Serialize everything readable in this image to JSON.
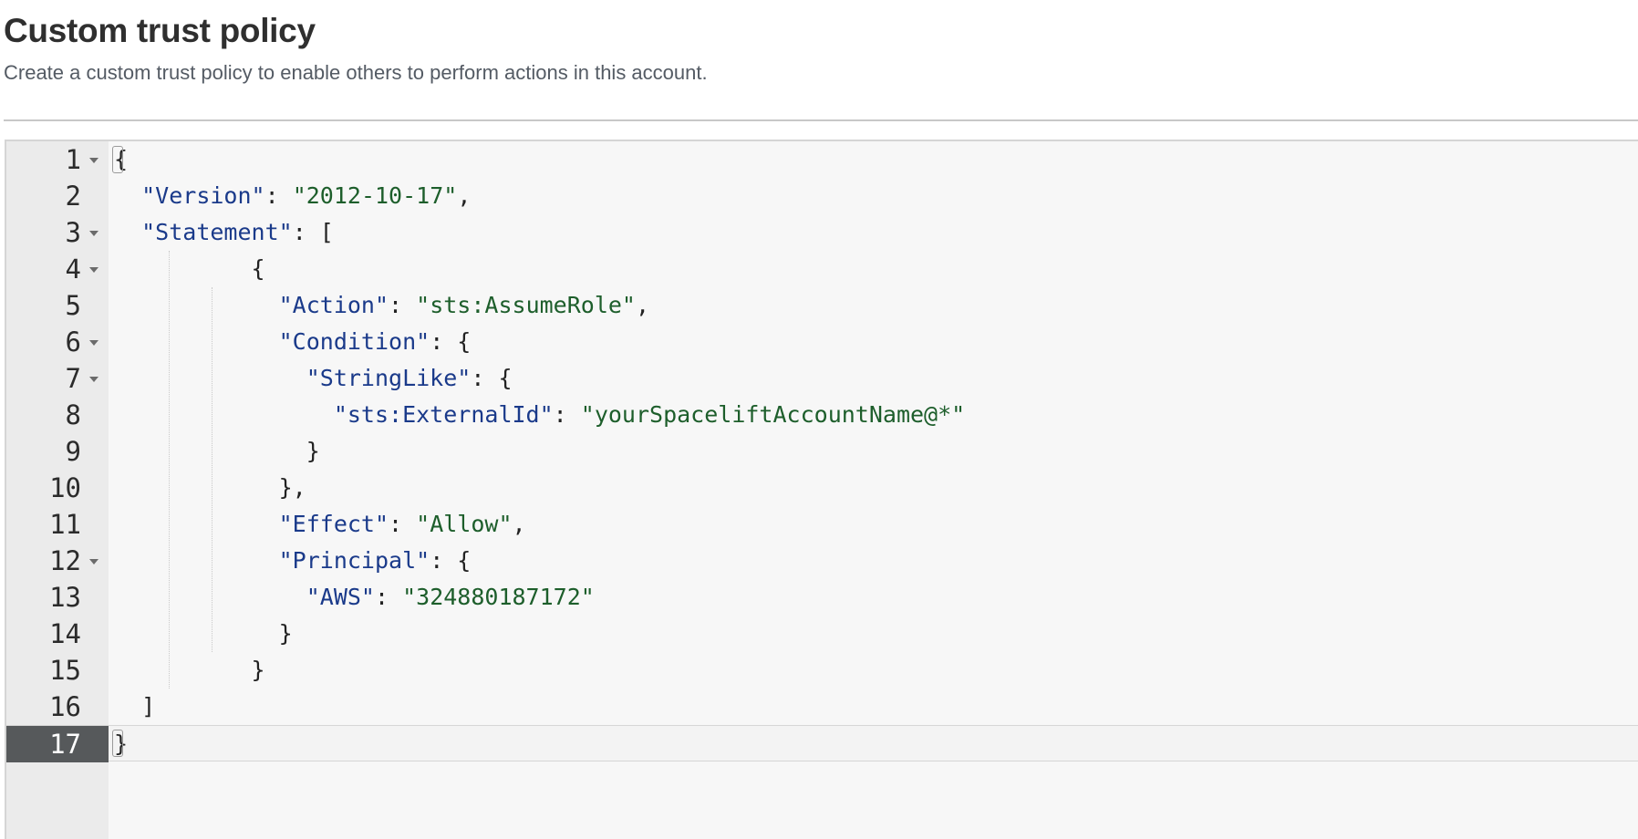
{
  "header": {
    "title": "Custom trust policy",
    "subtitle": "Create a custom trust policy to enable others to perform actions in this account."
  },
  "editor": {
    "language": "json",
    "active_line": 17,
    "lines": [
      {
        "num": "1",
        "text": "{"
      },
      {
        "num": "2",
        "text": "  \"Version\": \"2012-10-17\","
      },
      {
        "num": "3",
        "text": "  \"Statement\": ["
      },
      {
        "num": "4",
        "text": "          {"
      },
      {
        "num": "5",
        "text": "            \"Action\": \"sts:AssumeRole\","
      },
      {
        "num": "6",
        "text": "            \"Condition\": {"
      },
      {
        "num": "7",
        "text": "              \"StringLike\": {"
      },
      {
        "num": "8",
        "text": "                \"sts:ExternalId\": \"yourSpaceliftAccountName@*\""
      },
      {
        "num": "9",
        "text": "              }"
      },
      {
        "num": "10",
        "text": "            },"
      },
      {
        "num": "11",
        "text": "            \"Effect\": \"Allow\","
      },
      {
        "num": "12",
        "text": "            \"Principal\": {"
      },
      {
        "num": "13",
        "text": "              \"AWS\": \"324880187172\""
      },
      {
        "num": "14",
        "text": "            }"
      },
      {
        "num": "15",
        "text": "          }"
      },
      {
        "num": "16",
        "text": "  ]"
      },
      {
        "num": "17",
        "text": "}"
      }
    ],
    "foldable_lines": [
      1,
      3,
      4,
      6,
      7,
      12
    ],
    "colors": {
      "key": "#1a3a8a",
      "string": "#1d5e2b",
      "punctuation": "#222222",
      "gutter": "#ebebeb",
      "active_gutter": "#56595b",
      "background": "#f7f7f7"
    },
    "icons": {
      "fold": "fold-caret-icon"
    }
  }
}
